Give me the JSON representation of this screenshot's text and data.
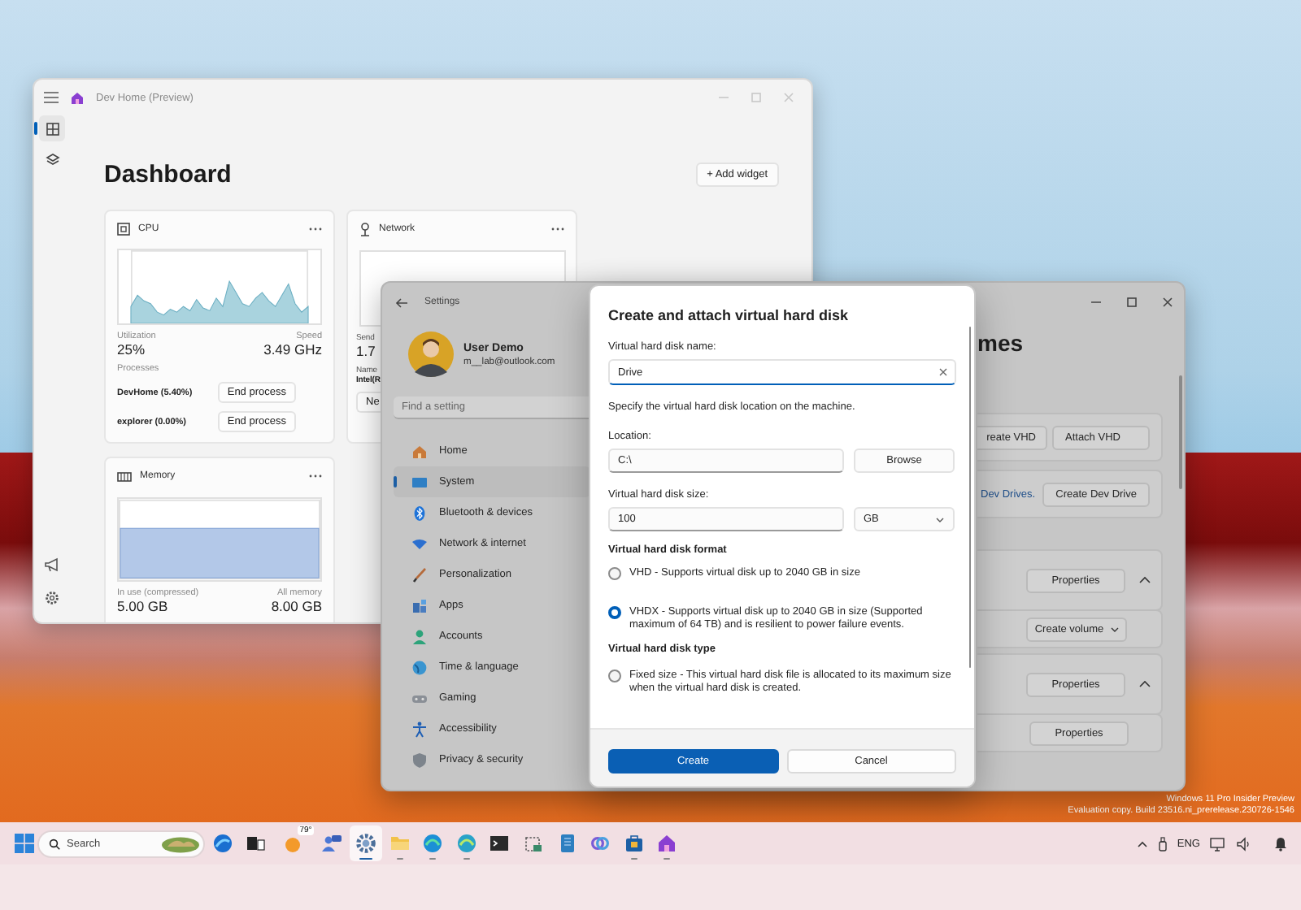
{
  "desktop": {
    "notice_lines": [
      "Windows 11 Pro Insider Preview",
      "Evaluation copy. Build 23516.ni_prerelease.230726-1546"
    ]
  },
  "dev_home": {
    "title": "Dev Home (Preview)",
    "nav": [
      {
        "kind": "dashboard",
        "selected": true
      },
      {
        "kind": "extensions",
        "selected": false
      }
    ],
    "heading": "Dashboard",
    "add_widget": "+ Add widget",
    "widgets": [
      {
        "kind": "cpu",
        "title": "CPU",
        "stats": [
          {
            "label": "Utilization",
            "value": "25%"
          },
          {
            "label": "Speed",
            "value": "3.49 GHz"
          }
        ],
        "processes_label": "Processes",
        "processes": [
          {
            "name": "DevHome (5.40%)",
            "action": "End process"
          },
          {
            "name": "explorer (0.00%)",
            "action": "End process"
          }
        ]
      },
      {
        "kind": "network",
        "title": "Network",
        "stat_label": "Send",
        "stat_value": "1.7",
        "name_label": "Name",
        "adapter": "Intel(R",
        "button": "Ne"
      },
      {
        "kind": "memory",
        "title": "Memory",
        "stats": [
          {
            "label": "In use (compressed)",
            "value": "5.00 GB"
          },
          {
            "label": "All memory",
            "value": "8.00 GB"
          }
        ]
      }
    ]
  },
  "settings": {
    "title": "Settings",
    "user": {
      "name": "User Demo",
      "email": "m__lab@outlook.com"
    },
    "search": {
      "placeholder": "Find a setting"
    },
    "nav": [
      {
        "kind": "home",
        "label": "Home",
        "selected": false
      },
      {
        "kind": "system",
        "label": "System",
        "selected": true
      },
      {
        "kind": "bluetooth",
        "label": "Bluetooth & devices",
        "selected": false
      },
      {
        "kind": "network",
        "label": "Network & internet",
        "selected": false
      },
      {
        "kind": "personalization",
        "label": "Personalization",
        "selected": false
      },
      {
        "kind": "apps",
        "label": "Apps",
        "selected": false
      },
      {
        "kind": "accounts",
        "label": "Accounts",
        "selected": false
      },
      {
        "kind": "time",
        "label": "Time & language",
        "selected": false
      },
      {
        "kind": "gaming",
        "label": "Gaming",
        "selected": false
      },
      {
        "kind": "accessibility",
        "label": "Accessibility",
        "selected": false
      },
      {
        "kind": "privacy",
        "label": "Privacy & security",
        "selected": false
      }
    ],
    "page_title": "mes",
    "rows": [
      {
        "kind": "buttons",
        "buttons": [
          "reate VHD",
          "Attach VHD"
        ]
      },
      {
        "kind": "link",
        "link": "Dev Drives.",
        "button": "Create Dev Drive"
      },
      {
        "kind": "expander",
        "button": "Properties",
        "expanded": true
      },
      {
        "kind": "dropdown",
        "button": "Create volume"
      },
      {
        "kind": "expander",
        "button": "Properties",
        "expanded": true
      },
      {
        "kind": "plain",
        "button": "Properties"
      }
    ]
  },
  "dialog": {
    "title": "Create and attach virtual hard disk",
    "name_label": "Virtual hard disk name:",
    "name_value": "Drive",
    "location_hint": "Specify the virtual hard disk location on the machine.",
    "location_label": "Location:",
    "location_value": "C:\\",
    "browse": "Browse",
    "size_label": "Virtual hard disk size:",
    "size_value": "100",
    "unit": "GB",
    "format_heading": "Virtual hard disk format",
    "formats": [
      {
        "label": "VHD - Supports virtual disk up to 2040 GB in size",
        "selected": false
      },
      {
        "label": "VHDX - Supports virtual disk up to 2040 GB in size (Supported maximum of 64 TB) and is resilient to power failure events.",
        "selected": true
      }
    ],
    "type_heading": "Virtual hard disk type",
    "types": [
      {
        "label": "Fixed size - This virtual hard disk file is allocated to its maximum size when the virtual hard disk is created.",
        "selected": false
      }
    ],
    "primary": "Create",
    "secondary": "Cancel"
  },
  "taskbar": {
    "search": {
      "placeholder": "Search"
    },
    "apps": [
      {
        "kind": "globe",
        "running": false,
        "selected": false
      },
      {
        "kind": "squares",
        "running": false,
        "selected": false
      },
      {
        "kind": "weather",
        "badge": "79°",
        "running": false,
        "selected": false
      },
      {
        "kind": "chat",
        "running": false,
        "selected": false
      },
      {
        "kind": "gear",
        "running": true,
        "selected": true
      },
      {
        "kind": "folder",
        "running": true,
        "selected": false
      },
      {
        "kind": "wave",
        "running": true,
        "selected": false
      },
      {
        "kind": "wave2",
        "running": true,
        "selected": false
      },
      {
        "kind": "terminal",
        "running": false,
        "selected": false
      },
      {
        "kind": "crop",
        "running": false,
        "selected": false
      },
      {
        "kind": "notebook",
        "running": false,
        "selected": false
      },
      {
        "kind": "knot",
        "running": false,
        "selected": false
      },
      {
        "kind": "bag",
        "running": true,
        "selected": false
      },
      {
        "kind": "house",
        "running": true,
        "selected": false
      }
    ],
    "language": "ENG"
  }
}
